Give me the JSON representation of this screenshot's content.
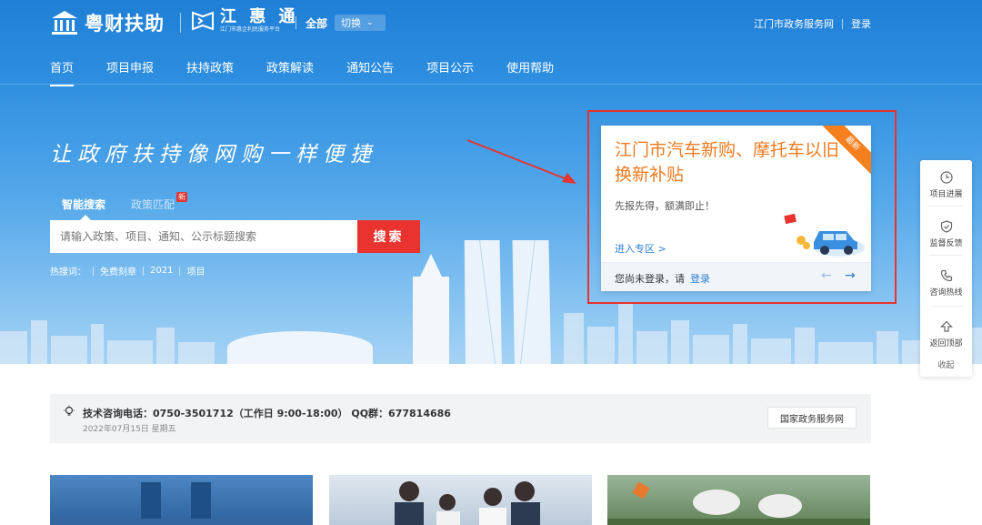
{
  "header": {
    "brand_name": "粤财扶助",
    "sub_brand_name": "江 惠 通",
    "sub_brand_tagline": "江门市惠企利民服务平台",
    "region_label": "全部",
    "switch_label": "切换",
    "gov_portal_link": "江门市政务服务网",
    "login_link": "登录"
  },
  "nav": {
    "items": [
      "首页",
      "项目申报",
      "扶持政策",
      "政策解读",
      "通知公告",
      "项目公示",
      "使用帮助"
    ],
    "active_index": 0
  },
  "hero": {
    "slogan": "让政府扶持像网购一样便捷",
    "search": {
      "tabs": [
        "智能搜索",
        "政策匹配"
      ],
      "new_badge": "新",
      "placeholder": "请输入政策、项目、通知、公示标题搜索",
      "button_label": "搜索",
      "hot_label": "热搜词：",
      "hot_words": [
        "免费刻章",
        "2021",
        "项目"
      ]
    }
  },
  "notice_card": {
    "ribbon": "最新",
    "title": "江门市汽车新购、摩托车以旧换新补贴",
    "subtitle": "先报先得，额满即止！",
    "enter_link": "进入专区 >",
    "login_prompt": "您尚未登录，请",
    "login_link": "登录",
    "prev_arrow": "←",
    "next_arrow": "→"
  },
  "side_panel": {
    "items": [
      "项目进展",
      "监督反馈",
      "咨询热线",
      "返回顶部"
    ],
    "collapse_label": "收起"
  },
  "info_bar": {
    "consult": "技术咨询电话：0750-3501712（工作日 9:00-18:00） QQ群：677814686",
    "date": "2022年07月15日  星期五",
    "national_portal_button": "国家政务服务网"
  },
  "colors": {
    "primary_blue": "#2b7fd2",
    "search_red": "#e8332e",
    "card_orange": "#ef7a20",
    "annotation_red": "#e8332e"
  }
}
